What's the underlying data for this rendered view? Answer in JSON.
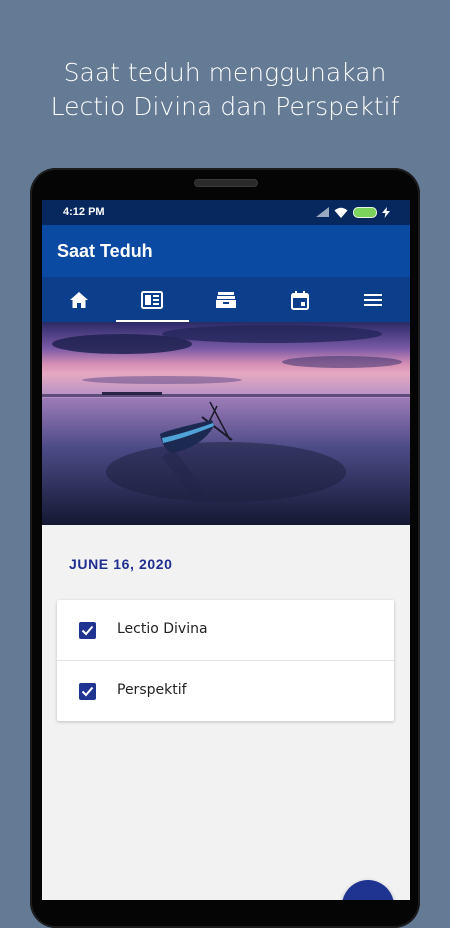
{
  "promo": {
    "line1": "Saat teduh menggunakan",
    "line2": "Lectio Divina dan Perspektif"
  },
  "status_bar": {
    "time": "4:12 PM",
    "icons": [
      "signal-icon",
      "wifi-icon",
      "battery-icon",
      "charging-icon"
    ]
  },
  "app": {
    "title": "Saat Teduh",
    "tabs": [
      {
        "icon": "home-icon",
        "active": false
      },
      {
        "icon": "bible-book-icon",
        "active": true
      },
      {
        "icon": "inbox-tray-icon",
        "active": false
      },
      {
        "icon": "calendar-icon",
        "active": false
      },
      {
        "icon": "menu-icon",
        "active": false
      }
    ]
  },
  "hero": {
    "image": "sunset-boat-on-lake"
  },
  "content": {
    "date": "JUNE 16, 2020",
    "items": [
      {
        "label": "Lectio Divina",
        "checked": true
      },
      {
        "label": "Perspektif",
        "checked": true
      }
    ]
  },
  "colors": {
    "background": "#647a95",
    "status_bar": "#06285e",
    "app_bar": "#0b4aa2",
    "tab_bar": "#0b3f8c",
    "accent": "#1f3391"
  }
}
